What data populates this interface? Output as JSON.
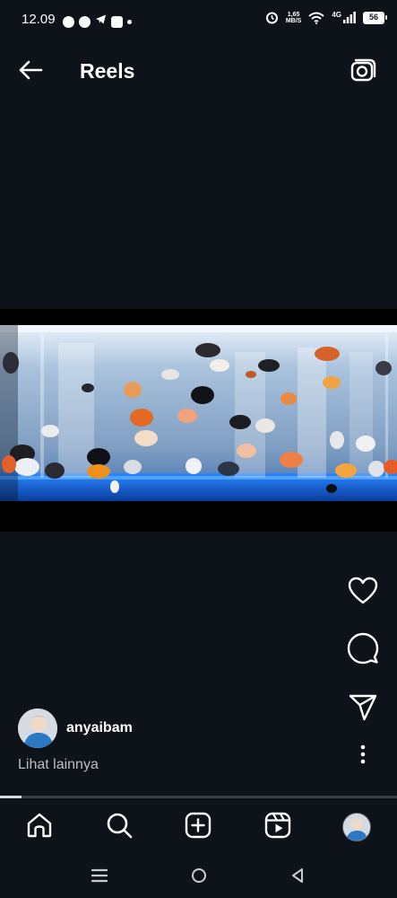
{
  "status_bar": {
    "time": "12.09",
    "net_speed_value": "1,65",
    "net_speed_unit": "MB/S",
    "net_type": "4G",
    "battery_level": "56"
  },
  "header": {
    "title": "Reels",
    "back_icon": "arrow-left-icon",
    "camera_icon": "camera-icon"
  },
  "video": {
    "progress_fraction": 0.055
  },
  "actions": {
    "like_icon": "heart-icon",
    "comment_icon": "comment-icon",
    "share_icon": "send-icon",
    "more_icon": "more-vertical-icon"
  },
  "author": {
    "username": "anyaibam",
    "see_more_label": "Lihat lainnya"
  },
  "bottom_nav": {
    "items": [
      "home-icon",
      "search-icon",
      "create-icon",
      "reels-icon",
      "profile-avatar"
    ]
  },
  "system_nav": {
    "items": [
      "recents-icon",
      "home-circle-icon",
      "back-triangle-icon"
    ]
  },
  "colors": {
    "background": "#0e1319",
    "text": "#ffffff",
    "muted_text": "#b9bec6",
    "aquarium_blue": "#1e6ad6"
  }
}
